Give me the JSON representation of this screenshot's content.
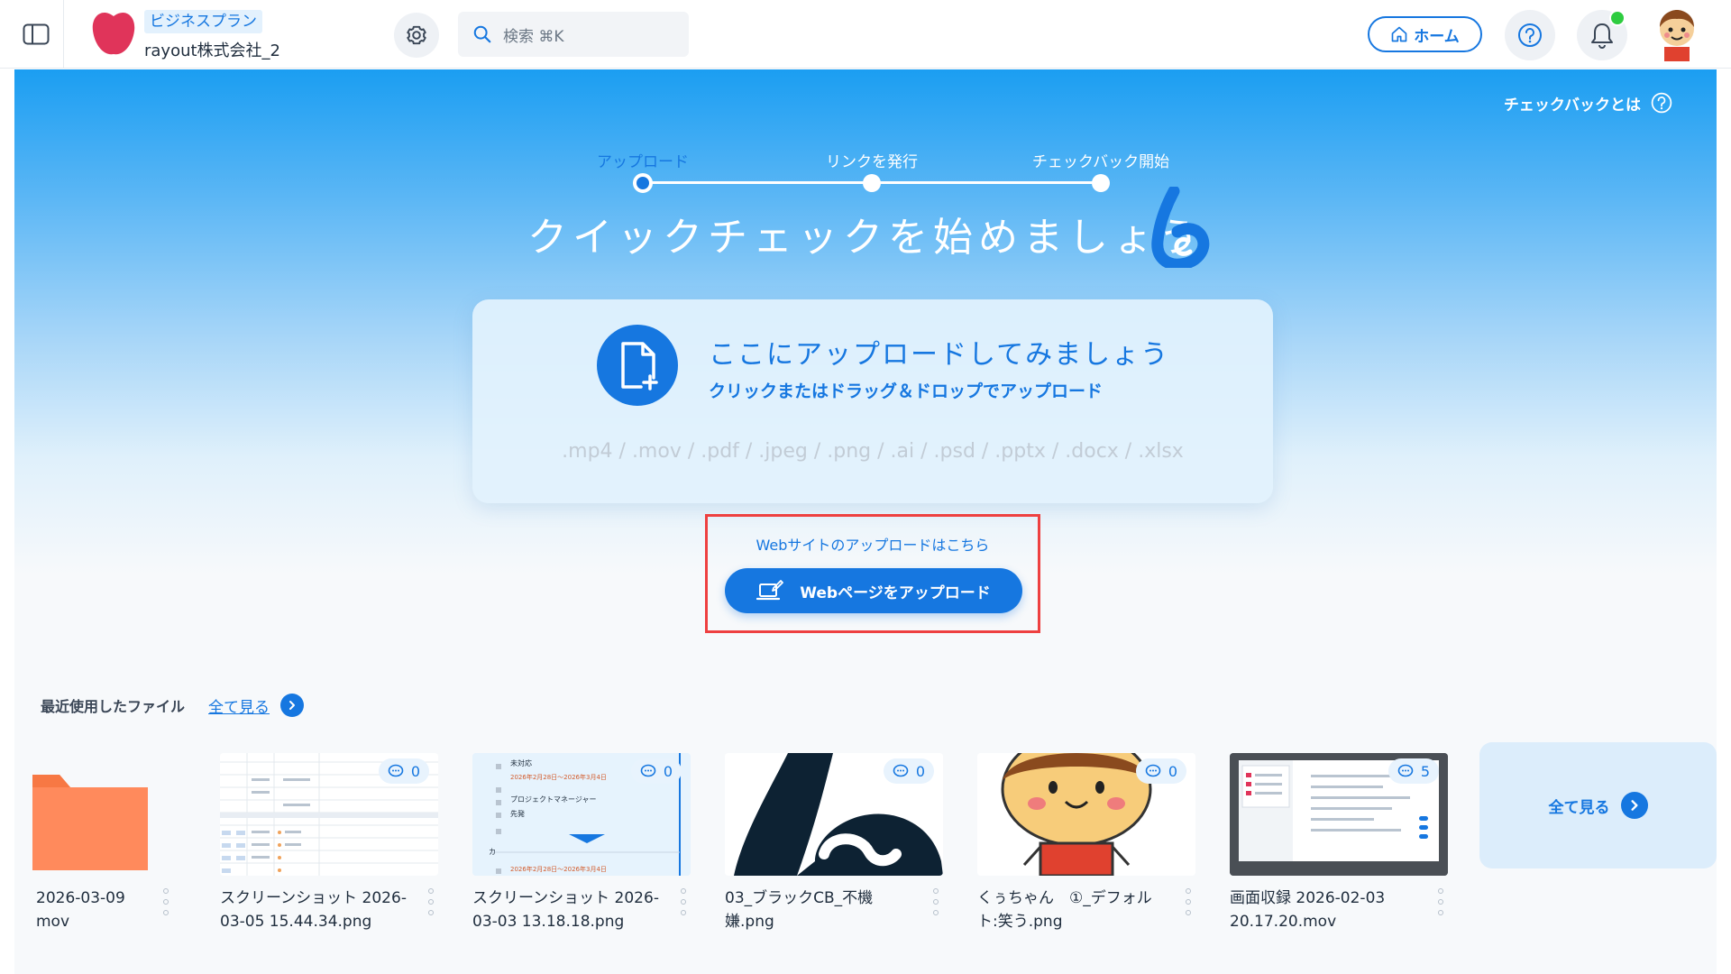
{
  "header": {
    "plan_badge": "ビジネスプラン",
    "org_name": "rayout株式会社_2",
    "search_placeholder": "検索 ⌘K",
    "home_label": "ホーム",
    "notification_has_unread": true
  },
  "hero": {
    "what_is_link": "チェックバックとは",
    "steps": [
      "アップロード",
      "リンクを発行",
      "チェックバック開始"
    ],
    "active_step": 0,
    "title": "クイックチェックを始めましょう"
  },
  "upload": {
    "heading": "ここにアップロードしてみましょう",
    "subheading": "クリックまたはドラッグ＆ドロップでアップロード",
    "formats": ".mp4 / .mov / .pdf / .jpeg / .png / .ai / .psd / .pptx / .docx / .xlsx"
  },
  "web_upload": {
    "hint": "Webサイトのアップロードはこちら",
    "button_label": "Webページをアップロード"
  },
  "recent": {
    "title": "最近使用したファイル",
    "see_all": "全て見る",
    "files": [
      {
        "name": "2026-03-09 ．mov",
        "name_line1": "2026-03-09",
        "name_line2": "mov",
        "thumb": "folder",
        "comments": null
      },
      {
        "name_line1": "スクリーンショット 2026-",
        "name_line2": "03-05 15.44.34.png",
        "thumb": "spreadsheet",
        "comments": "0"
      },
      {
        "name_line1": "スクリーンショット 2026-",
        "name_line2": "03-03 13.18.18.png",
        "thumb": "list",
        "comments": "0"
      },
      {
        "name_line1": "03_ブラックCB_不機",
        "name_line2": "嫌.png",
        "thumb": "black-logo",
        "comments": "0"
      },
      {
        "name_line1": "くぅちゃん　①_デフォル",
        "name_line2": "ト:笑う.png",
        "thumb": "character",
        "comments": "0"
      },
      {
        "name_line1": "画面収録 2026-02-03",
        "name_line2": "20.17.20.mov",
        "thumb": "screen-recording",
        "comments": "5"
      }
    ],
    "see_all_card": "全て見る"
  },
  "thumb_text": {
    "list_status": "未対応",
    "list_date": "2026年2月28日〜2026年3月4日",
    "list_role": "プロジェクトマネージャー",
    "list_item": "先発",
    "list_footer_char": "カ",
    "list_date_2": "2026年2月28日〜2026年3月4日"
  },
  "colors": {
    "accent": "#1677e0",
    "highlight_border": "#ee4040",
    "notification": "#2ecc40",
    "brand": "#e0345a"
  },
  "icons": {
    "sidebar": "sidebar-toggle-icon",
    "settings": "gear-icon",
    "search": "search-icon",
    "home": "house-icon",
    "help": "question-icon",
    "notifications": "bell-icon",
    "upload": "file-plus-icon",
    "web": "laptop-edit-icon",
    "comments": "comment-icon",
    "arrow": "chevron-right-icon"
  }
}
